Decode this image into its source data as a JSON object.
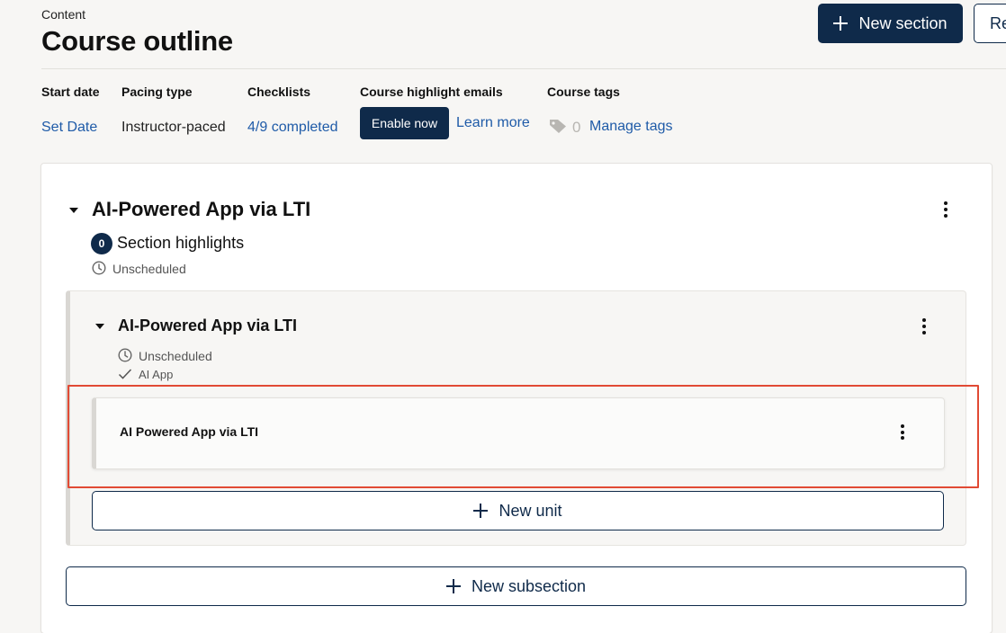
{
  "header": {
    "breadcrumb": "Content",
    "title": "Course outline",
    "new_section_label": "New section",
    "secondary_button_label": "Re"
  },
  "status_bar": {
    "start_date": {
      "label": "Start date",
      "value": "Set Date"
    },
    "pacing_type": {
      "label": "Pacing type",
      "value": "Instructor-paced"
    },
    "checklists": {
      "label": "Checklists",
      "value": "4/9 completed"
    },
    "highlight_emails": {
      "label": "Course highlight emails",
      "enable_label": "Enable now",
      "learn_more": "Learn more"
    },
    "course_tags": {
      "label": "Course tags",
      "count": "0",
      "manage_label": "Manage tags"
    }
  },
  "section": {
    "title": "AI-Powered App via LTI",
    "highlights_count": "0",
    "highlights_label": "Section highlights",
    "schedule_status": "Unscheduled",
    "subsection": {
      "title": "AI-Powered App via LTI",
      "schedule_status": "Unscheduled",
      "grading_label": "AI App",
      "unit": {
        "title": "AI Powered App via LTI"
      },
      "new_unit_label": "New unit"
    },
    "new_subsection_label": "New subsection"
  },
  "colors": {
    "primary": "#0f2a4a",
    "link": "#1f5ba8",
    "highlight_border": "#e14a34",
    "page_bg": "#f7f6f4"
  }
}
